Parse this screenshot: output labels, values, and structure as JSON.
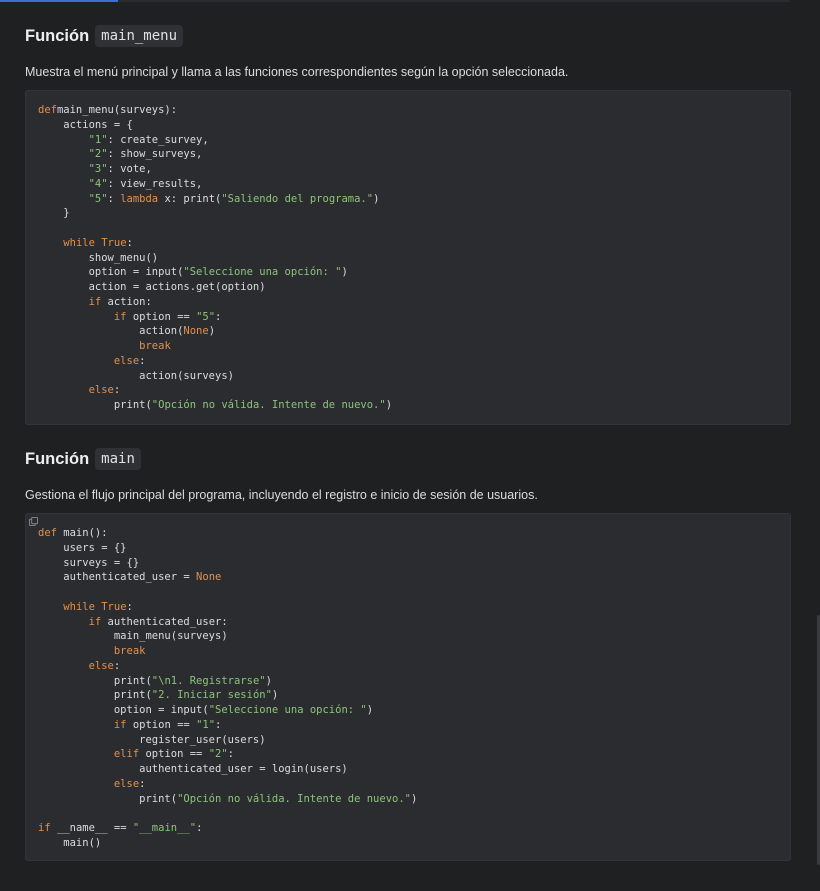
{
  "sections": [
    {
      "heading_word": "Función",
      "heading_code": "main_menu",
      "description": "Muestra el menú principal y llama a las funciones correspondientes según la opción seleccionada.",
      "code": [
        [
          [
            "kw",
            "def"
          ],
          [
            "",
            "main_menu(surveys):"
          ]
        ],
        [
          [
            "",
            "    actions = {"
          ]
        ],
        [
          [
            "",
            "        "
          ],
          [
            "str",
            "\"1\""
          ],
          [
            "",
            ": create_survey,"
          ]
        ],
        [
          [
            "",
            "        "
          ],
          [
            "str",
            "\"2\""
          ],
          [
            "",
            ": show_surveys,"
          ]
        ],
        [
          [
            "",
            "        "
          ],
          [
            "str",
            "\"3\""
          ],
          [
            "",
            ": vote,"
          ]
        ],
        [
          [
            "",
            "        "
          ],
          [
            "str",
            "\"4\""
          ],
          [
            "",
            ": view_results,"
          ]
        ],
        [
          [
            "",
            "        "
          ],
          [
            "str",
            "\"5\""
          ],
          [
            "",
            ": "
          ],
          [
            "kw",
            "lambda"
          ],
          [
            "",
            " x: print("
          ],
          [
            "str",
            "\"Saliendo del programa.\""
          ],
          [
            "",
            ")"
          ]
        ],
        [
          [
            "",
            "    }"
          ]
        ],
        [
          [
            "",
            ""
          ]
        ],
        [
          [
            "",
            "    "
          ],
          [
            "kw",
            "while"
          ],
          [
            "",
            " "
          ],
          [
            "const",
            "True"
          ],
          [
            "",
            ":"
          ]
        ],
        [
          [
            "",
            "        show_menu()"
          ]
        ],
        [
          [
            "",
            "        option = input("
          ],
          [
            "str",
            "\"Seleccione una opción: \""
          ],
          [
            "",
            ")"
          ]
        ],
        [
          [
            "",
            "        action = actions.get(option)"
          ]
        ],
        [
          [
            "",
            "        "
          ],
          [
            "kw",
            "if"
          ],
          [
            "",
            " action:"
          ]
        ],
        [
          [
            "",
            "            "
          ],
          [
            "kw",
            "if"
          ],
          [
            "",
            " option == "
          ],
          [
            "str",
            "\"5\""
          ],
          [
            "",
            ":"
          ]
        ],
        [
          [
            "",
            "                action("
          ],
          [
            "const",
            "None"
          ],
          [
            "",
            ")"
          ]
        ],
        [
          [
            "",
            "                "
          ],
          [
            "kw",
            "break"
          ]
        ],
        [
          [
            "",
            "            "
          ],
          [
            "kw",
            "else"
          ],
          [
            "",
            ":"
          ]
        ],
        [
          [
            "",
            "                action(surveys)"
          ]
        ],
        [
          [
            "",
            "        "
          ],
          [
            "kw",
            "else"
          ],
          [
            "",
            ":"
          ]
        ],
        [
          [
            "",
            "            print("
          ],
          [
            "str",
            "\"Opción no válida. Intente de nuevo.\""
          ],
          [
            "",
            ")"
          ]
        ]
      ]
    },
    {
      "heading_word": "Función",
      "heading_code": "main",
      "description": "Gestiona el flujo principal del programa, incluyendo el registro e inicio de sesión de usuarios.",
      "code": [
        [
          [
            "kw",
            "def"
          ],
          [
            "",
            " main():"
          ]
        ],
        [
          [
            "",
            "    users = {}"
          ]
        ],
        [
          [
            "",
            "    surveys = {}"
          ]
        ],
        [
          [
            "",
            "    authenticated_user = "
          ],
          [
            "const",
            "None"
          ]
        ],
        [
          [
            "",
            ""
          ]
        ],
        [
          [
            "",
            "    "
          ],
          [
            "kw",
            "while"
          ],
          [
            "",
            " "
          ],
          [
            "const",
            "True"
          ],
          [
            "",
            ":"
          ]
        ],
        [
          [
            "",
            "        "
          ],
          [
            "kw",
            "if"
          ],
          [
            "",
            " authenticated_user:"
          ]
        ],
        [
          [
            "",
            "            main_menu(surveys)"
          ]
        ],
        [
          [
            "",
            "            "
          ],
          [
            "kw",
            "break"
          ]
        ],
        [
          [
            "",
            "        "
          ],
          [
            "kw",
            "else"
          ],
          [
            "",
            ":"
          ]
        ],
        [
          [
            "",
            "            print("
          ],
          [
            "str",
            "\"\\n1. Registrarse\""
          ],
          [
            "",
            ")"
          ]
        ],
        [
          [
            "",
            "            print("
          ],
          [
            "str",
            "\"2. Iniciar sesión\""
          ],
          [
            "",
            ")"
          ]
        ],
        [
          [
            "",
            "            option = input("
          ],
          [
            "str",
            "\"Seleccione una opción: \""
          ],
          [
            "",
            ")"
          ]
        ],
        [
          [
            "",
            "            "
          ],
          [
            "kw",
            "if"
          ],
          [
            "",
            " option == "
          ],
          [
            "str",
            "\"1\""
          ],
          [
            "",
            ":"
          ]
        ],
        [
          [
            "",
            "                register_user(users)"
          ]
        ],
        [
          [
            "",
            "            "
          ],
          [
            "kw",
            "elif"
          ],
          [
            "",
            " option == "
          ],
          [
            "str",
            "\"2\""
          ],
          [
            "",
            ":"
          ]
        ],
        [
          [
            "",
            "                authenticated_user = login(users)"
          ]
        ],
        [
          [
            "",
            "            "
          ],
          [
            "kw",
            "else"
          ],
          [
            "",
            ":"
          ]
        ],
        [
          [
            "",
            "                print("
          ],
          [
            "str",
            "\"Opción no válida. Intente de nuevo.\""
          ],
          [
            "",
            ")"
          ]
        ],
        [
          [
            "",
            ""
          ]
        ],
        [
          [
            "kw",
            "if"
          ],
          [
            "",
            " __name__ == "
          ],
          [
            "str",
            "\"__main__\""
          ],
          [
            "",
            ":"
          ]
        ],
        [
          [
            "",
            "    main()"
          ]
        ]
      ]
    }
  ],
  "icons": {
    "copy": "copy-icon"
  },
  "colors": {
    "keyword": "#e0914f",
    "string": "#8cc47a",
    "background": "#1f2022",
    "code_bg": "#2b2c2f"
  }
}
